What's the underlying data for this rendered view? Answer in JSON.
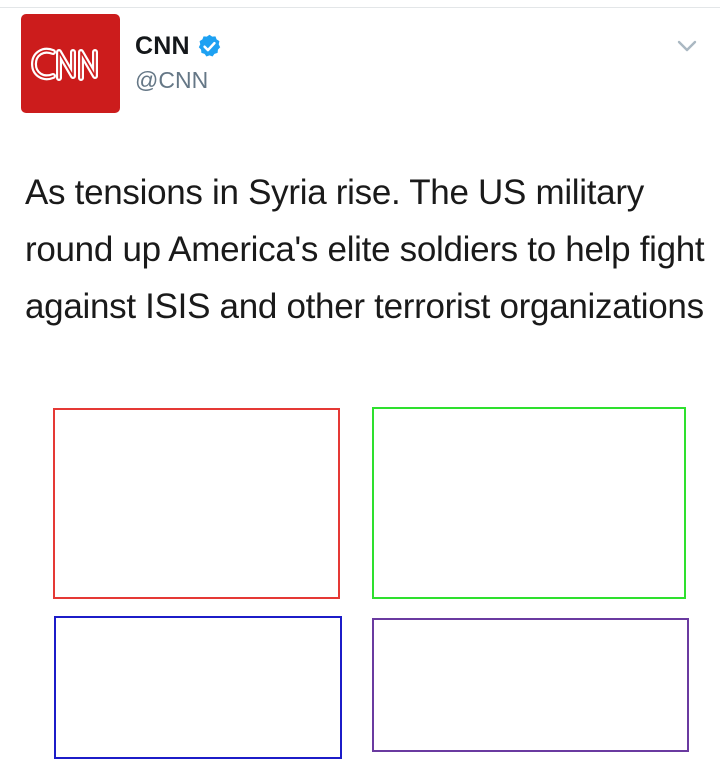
{
  "tweet": {
    "avatar_logo_text": "CNN",
    "display_name": "CNN",
    "handle": "@CNN",
    "text": "As tensions in Syria rise. The US military round up America's elite soldiers to help fight against ISIS and other terrorist organizations",
    "verified": true,
    "icons": {
      "verified": "verified-badge-icon",
      "menu": "chevron-down-icon"
    }
  },
  "media": {
    "boxes": [
      {
        "id": "top-left",
        "border_color": "#e53935"
      },
      {
        "id": "top-right",
        "border_color": "#2ee02e"
      },
      {
        "id": "bottom-left",
        "border_color": "#1c1cc8"
      },
      {
        "id": "bottom-right",
        "border_color": "#6a3aa0"
      }
    ]
  },
  "colors": {
    "brand_red": "#cc1c1c",
    "verified_blue": "#1da1f2",
    "handle_gray": "#657786"
  }
}
